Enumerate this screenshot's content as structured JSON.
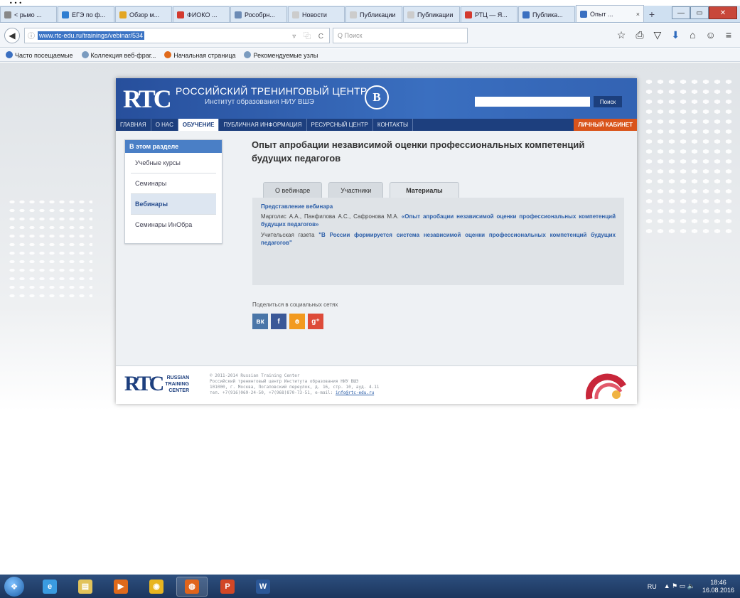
{
  "doc_caption": "…",
  "browser": {
    "tabs": [
      {
        "label": "< рьмо ...",
        "color": "#888888",
        "active": false
      },
      {
        "label": "ЕГЭ по ф...",
        "color": "#2e7dd1",
        "active": false
      },
      {
        "label": "Обзор м...",
        "color": "#e3a623",
        "active": false
      },
      {
        "label": "ФИОКО ...",
        "color": "#d33a2f",
        "active": false
      },
      {
        "label": "Рособрн...",
        "color": "#6c8bb5",
        "active": false
      },
      {
        "label": "Новости",
        "color": "#cccccc",
        "active": false
      },
      {
        "label": "Публикации",
        "color": "#cccccc",
        "active": false
      },
      {
        "label": "Публикации",
        "color": "#cccccc",
        "active": false
      },
      {
        "label": "РТЦ — Я...",
        "color": "#d33a2f",
        "active": false
      },
      {
        "label": "Публика...",
        "color": "#3a6fc0",
        "active": false
      },
      {
        "label": "Опыт ...",
        "color": "#3a6fc0",
        "active": true
      }
    ],
    "tab_close": "×",
    "new_tab": "+",
    "url": "www.rtc-edu.ru/trainings/vebinar/534",
    "url_info": "ⓘ",
    "url_tools": "▿ ⿻ C",
    "search_placeholder": "Q Поиск",
    "nav_icons": [
      "☆",
      "⎙",
      "▽",
      "⬇",
      "⌂",
      "☺",
      "≡"
    ],
    "bookmarks": [
      {
        "label": "Часто посещаемые",
        "color": "#3a6fc0"
      },
      {
        "label": "Коллекция веб-фраг...",
        "color": "#7a9bbf"
      },
      {
        "label": "Начальная страница",
        "color": "#e06a1b"
      },
      {
        "label": "Рекомендуемые узлы",
        "color": "#7a9bbf"
      }
    ],
    "window_buttons": [
      "—",
      "▭",
      "✕"
    ]
  },
  "site": {
    "logo": "RTC",
    "title": "РОССИЙСКИЙ ТРЕНИНГОВЫЙ ЦЕНТР",
    "subtitle": "Институт образования НИУ ВШЭ",
    "hse_badge": "B",
    "search_button": "Поиск",
    "menu": [
      {
        "label": "ГЛАВНАЯ",
        "active": false
      },
      {
        "label": "О НАС",
        "active": false
      },
      {
        "label": "ОБУЧЕНИЕ",
        "active": true
      },
      {
        "label": "ПУБЛИЧНАЯ ИНФОРМАЦИЯ",
        "active": false
      },
      {
        "label": "РЕСУРСНЫЙ ЦЕНТР",
        "active": false
      },
      {
        "label": "КОНТАКТЫ",
        "active": false
      }
    ],
    "cabinet": "ЛИЧНЫЙ КАБИНЕТ",
    "sidebar": {
      "heading": "В этом разделе",
      "items": [
        {
          "label": "Учебные курсы",
          "active": false
        },
        {
          "label": "Семинары",
          "active": false
        },
        {
          "label": "Вебинары",
          "active": true
        },
        {
          "label": "Семинары ИнОбра",
          "active": false
        }
      ]
    },
    "page_title": "Опыт апробации независимой оценки профессиональных компетенций будущих педагогов",
    "tabs": [
      {
        "label": "О вебинаре",
        "active": false
      },
      {
        "label": "Участники",
        "active": false
      },
      {
        "label": "Материалы",
        "active": true
      }
    ],
    "panel": {
      "heading": "Представление вебинара",
      "p1_text": "Марголис А.А., Панфилова А.С., Сафронова М.А. ",
      "p1_link": "«Опыт апробации независимой оценки профессиональных компетенций будущих педагогов»",
      "p2_text": "Учительская газета ",
      "p2_link": "\"В России формируется система независимой оценки профессиональных компетенций будущих педагогов\""
    },
    "share_label": "Поделиться в социальных сетях",
    "share_buttons": [
      {
        "label": "vk",
        "color": "#4a76a8"
      },
      {
        "label": "f",
        "color": "#3b5998"
      },
      {
        "label": "ok",
        "color": "#f29a1f"
      },
      {
        "label": "g+",
        "color": "#dd4b39"
      }
    ],
    "footer": {
      "logo": "RTC",
      "logo_words": [
        "RUSSIAN",
        "TRAINING",
        "CENTER"
      ],
      "lines": [
        "© 2011-2014 Russian Training Center",
        "Российский тренинговый центр Института образования НИУ ВШЭ",
        "101000, г. Москва, Потаповский переулок, д. 16, стр. 10, ауд. 4.11",
        "тел. +7(916)069-24-50, +7(968)870-73-51, e-mail: "
      ],
      "email": "info@rtc-edu.ru"
    }
  },
  "taskbar": {
    "items": [
      {
        "name": "ie-icon",
        "glyph": "e",
        "color": "#3a9be0"
      },
      {
        "name": "explorer-icon",
        "glyph": "▤",
        "color": "#e2c35a"
      },
      {
        "name": "media-player-icon",
        "glyph": "▶",
        "color": "#e06a1b"
      },
      {
        "name": "chrome-icon",
        "glyph": "◉",
        "color": "#e8b520"
      },
      {
        "name": "firefox-icon",
        "glyph": "◍",
        "color": "#e0641b"
      },
      {
        "name": "powerpoint-icon",
        "glyph": "P",
        "color": "#d24726"
      },
      {
        "name": "word-icon",
        "glyph": "W",
        "color": "#2b5797"
      }
    ],
    "lang": "RU",
    "tray_icons": "▲ ⚑ ▭ 🔈",
    "time": "18:46",
    "date": "16.08.2016"
  }
}
